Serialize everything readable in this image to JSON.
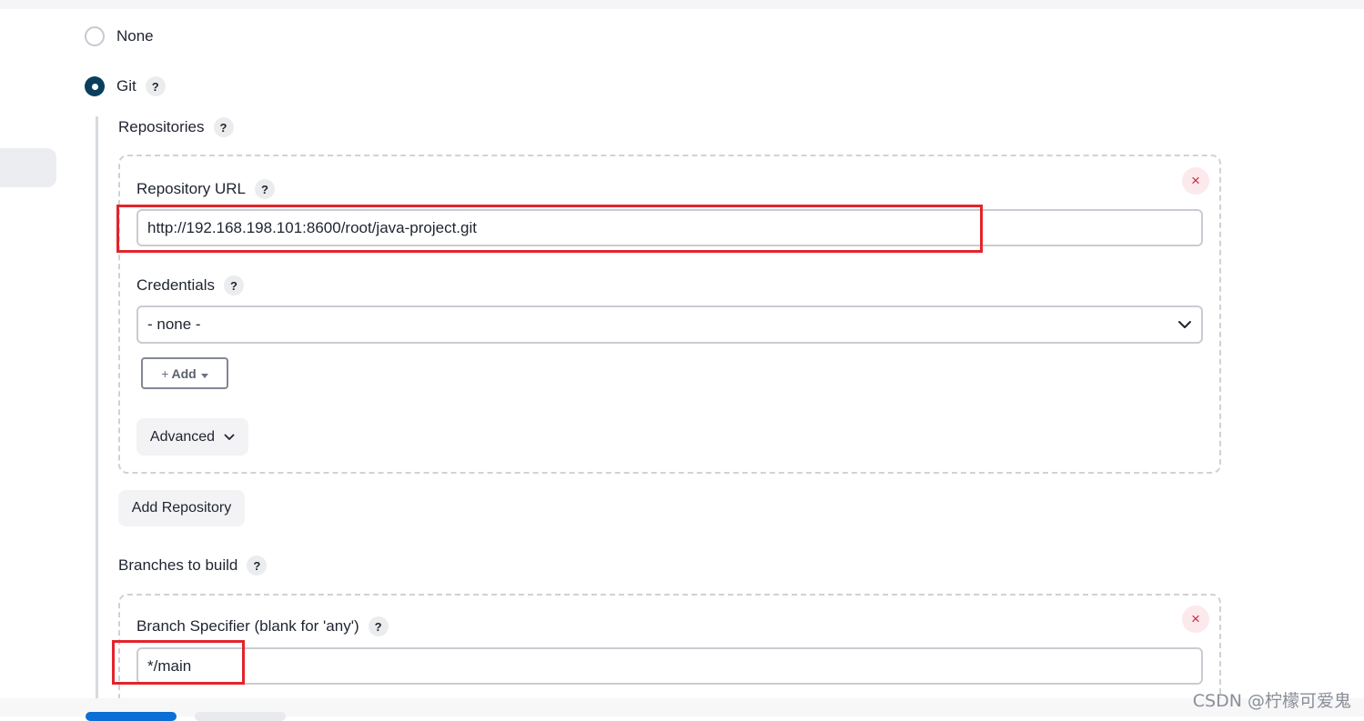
{
  "scm": {
    "options": [
      {
        "label": "None",
        "selected": false
      },
      {
        "label": "Git",
        "selected": true
      }
    ]
  },
  "help_glyph": "?",
  "remove_glyph": "×",
  "git": {
    "repositories_label": "Repositories",
    "repository_url_label": "Repository URL",
    "repository_url_value": "http://192.168.198.101:8600/root/java-project.git",
    "credentials_label": "Credentials",
    "credentials_value": "- none -",
    "add_plus": "+",
    "add_label": "Add",
    "advanced_label": "Advanced",
    "add_repository_label": "Add Repository",
    "branches_label": "Branches to build",
    "branch_specifier_label": "Branch Specifier (blank for 'any')",
    "branch_specifier_value": "*/main"
  },
  "watermark": "CSDN @柠檬可爱鬼",
  "colors": {
    "accent": "#0a3e5f",
    "highlight": "#e3242b",
    "remove": "#d7263d",
    "primary_button": "#0b6fd6"
  }
}
